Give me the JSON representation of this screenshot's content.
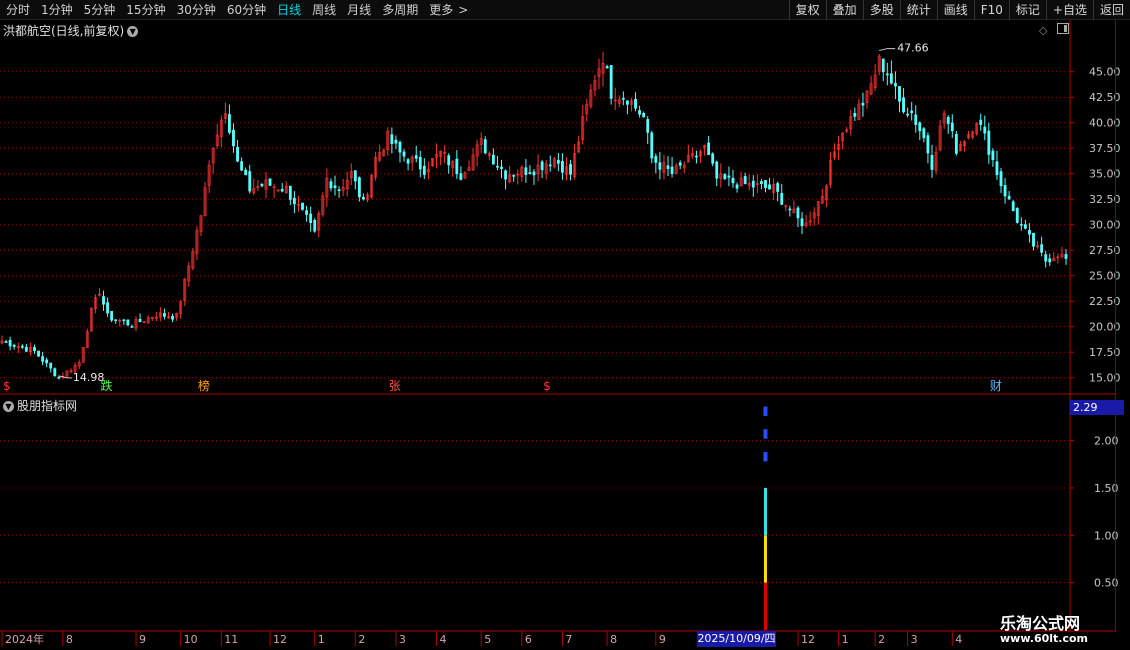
{
  "toolbar": {
    "periods": [
      "分时",
      "1分钟",
      "5分钟",
      "15分钟",
      "30分钟",
      "60分钟",
      "日线",
      "周线",
      "月线",
      "多周期",
      "更多"
    ],
    "active_period": "日线",
    "more_arrow": ">",
    "right_buttons": [
      "复权",
      "叠加",
      "多股",
      "统计",
      "画线",
      "F10",
      "标记",
      "+自选",
      "返回"
    ]
  },
  "stock": {
    "title": "洪都航空(日线,前复权)"
  },
  "indicator": {
    "title": "股朋指标网",
    "current_value": "2.29"
  },
  "crosshair": {
    "date_label": "2025/10/09/四"
  },
  "watermark": {
    "line1": "乐淘公式网",
    "line2": "www.60lt.com"
  },
  "colors": {
    "up": "#ff3232",
    "down": "#54ffff",
    "grid": "#8b0000",
    "axis": "#b30000"
  },
  "chart_data": {
    "type": "candlestick",
    "price_axis": {
      "ticks": [
        "45.00",
        "42.50",
        "40.00",
        "37.50",
        "35.00",
        "32.50",
        "30.00",
        "27.50",
        "25.00",
        "22.50",
        "20.00",
        "17.50",
        "15.00"
      ],
      "ylim": [
        13.5,
        48.5
      ]
    },
    "indicator_axis": {
      "ticks": [
        "2.00",
        "1.50",
        "1.00",
        "0.50"
      ],
      "ylim": [
        0,
        2.45
      ]
    },
    "x_axis": {
      "labels": [
        "2024年",
        "8",
        "9",
        "10",
        "11",
        "12",
        "1",
        "2",
        "3",
        "4",
        "5",
        "6",
        "7",
        "8",
        "9",
        "12",
        "1",
        "2",
        "3",
        "4"
      ],
      "label_bars": [
        0,
        15,
        33,
        44,
        54,
        66,
        77,
        87,
        97,
        107,
        118,
        128,
        138,
        149,
        161,
        196,
        206,
        215,
        223,
        234
      ]
    },
    "price_anchors": [
      [
        0,
        18.6
      ],
      [
        8,
        17.6
      ],
      [
        14,
        14.98
      ],
      [
        19,
        16.5
      ],
      [
        22,
        21.5
      ],
      [
        24,
        23.5
      ],
      [
        26,
        21.0
      ],
      [
        32,
        20.2
      ],
      [
        38,
        21.2
      ],
      [
        43,
        21.0
      ],
      [
        46,
        26.0
      ],
      [
        49,
        31.0
      ],
      [
        52,
        38.0
      ],
      [
        55,
        41.5
      ],
      [
        58,
        36.0
      ],
      [
        61,
        33.5
      ],
      [
        65,
        34.0
      ],
      [
        70,
        33.5
      ],
      [
        75,
        30.5
      ],
      [
        77,
        29.0
      ],
      [
        80,
        34.5
      ],
      [
        83,
        33.5
      ],
      [
        86,
        35.0
      ],
      [
        89,
        32.0
      ],
      [
        92,
        36.5
      ],
      [
        95,
        38.5
      ],
      [
        98,
        37.0
      ],
      [
        104,
        35.5
      ],
      [
        108,
        37.0
      ],
      [
        113,
        35.0
      ],
      [
        118,
        38.0
      ],
      [
        124,
        35.0
      ],
      [
        131,
        35.5
      ],
      [
        136,
        36.5
      ],
      [
        140,
        35.0
      ],
      [
        143,
        40.0
      ],
      [
        146,
        44.5
      ],
      [
        148,
        46.5
      ],
      [
        150,
        43.0
      ],
      [
        154,
        42.5
      ],
      [
        158,
        40.5
      ],
      [
        160,
        36.5
      ],
      [
        165,
        35.0
      ],
      [
        170,
        36.5
      ],
      [
        173,
        37.5
      ],
      [
        176,
        34.5
      ],
      [
        182,
        34.0
      ],
      [
        190,
        33.5
      ],
      [
        196,
        30.5
      ],
      [
        198,
        30.0
      ],
      [
        202,
        33.0
      ],
      [
        206,
        38.5
      ],
      [
        210,
        41.0
      ],
      [
        213,
        42.5
      ],
      [
        216,
        46.0
      ],
      [
        218,
        45.0
      ],
      [
        221,
        42.0
      ],
      [
        224,
        41.0
      ],
      [
        227,
        38.5
      ],
      [
        229,
        36.0
      ],
      [
        232,
        41.0
      ],
      [
        235,
        37.5
      ],
      [
        238,
        39.0
      ],
      [
        240,
        40.5
      ],
      [
        243,
        37.5
      ],
      [
        246,
        34.0
      ],
      [
        250,
        30.5
      ],
      [
        254,
        28.0
      ],
      [
        257,
        26.5
      ],
      [
        260,
        27.2
      ],
      [
        262,
        26.6
      ]
    ],
    "total_bars": 263,
    "max_label": "47.66",
    "min_label": "14.98",
    "event_markers": [
      {
        "bar": 0,
        "text": "$",
        "color": "#ff3232"
      },
      {
        "bar": 24,
        "text": "跌",
        "color": "#4cff4c"
      },
      {
        "bar": 48,
        "text": "榜",
        "color": "#ffa500"
      },
      {
        "bar": 95,
        "text": "张",
        "color": "#ff4d4d"
      },
      {
        "bar": 133,
        "text": "$",
        "color": "#ff3232"
      },
      {
        "bar": 243,
        "text": "财",
        "color": "#5fb7ff"
      }
    ],
    "indicator_bar": {
      "bar": 188,
      "segments": [
        {
          "from": 0,
          "to": 0.5,
          "color": "#e10000"
        },
        {
          "from": 0.5,
          "to": 1.0,
          "color": "#ffe000"
        },
        {
          "from": 1.0,
          "to": 1.5,
          "color": "#33e6e6"
        }
      ],
      "dashes": [
        {
          "from": 1.78,
          "to": 1.88,
          "color": "#2a4cff"
        },
        {
          "from": 2.02,
          "to": 2.12,
          "color": "#2a4cff"
        },
        {
          "from": 2.26,
          "to": 2.36,
          "color": "#2a4cff"
        }
      ]
    }
  }
}
